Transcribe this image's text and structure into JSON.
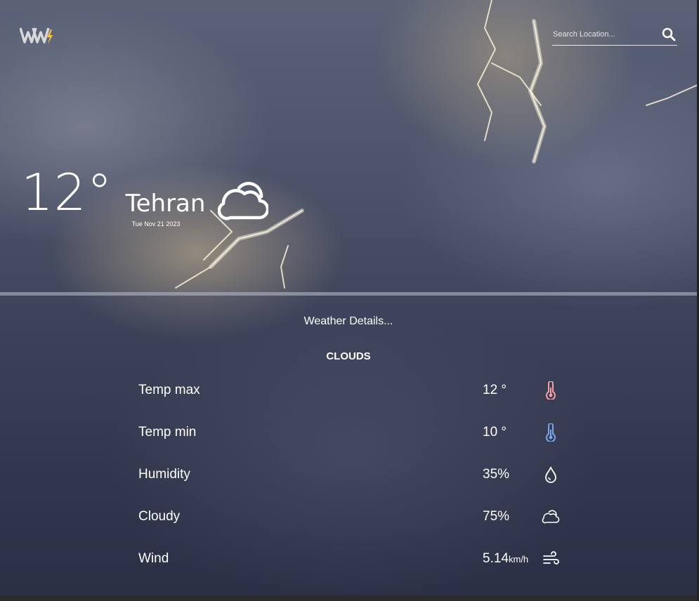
{
  "header": {
    "logo_text": "WW",
    "search": {
      "placeholder": "Search Location..."
    }
  },
  "current": {
    "temperature": "12°",
    "city": "Tehran",
    "date": "Tue Nov 21 2023",
    "condition_icon": "cloud-icon"
  },
  "details": {
    "title": "Weather Details...",
    "condition": "CLOUDS",
    "rows": [
      {
        "label": "Temp max",
        "value": "12 °",
        "unit": "",
        "icon": "thermometer-hot-icon",
        "icon_color": "#f2a0a6"
      },
      {
        "label": "Temp min",
        "value": "10 °",
        "unit": "",
        "icon": "thermometer-cold-icon",
        "icon_color": "#7aa7e8"
      },
      {
        "label": "Humidity",
        "value": "35%",
        "unit": "",
        "icon": "droplet-icon",
        "icon_color": "#ffffff"
      },
      {
        "label": "Cloudy",
        "value": "75%",
        "unit": "",
        "icon": "cloud-icon",
        "icon_color": "#ffffff"
      },
      {
        "label": "Wind",
        "value": "5.14",
        "unit": "km/h",
        "icon": "wind-icon",
        "icon_color": "#ffffff"
      }
    ]
  },
  "colors": {
    "logo_accent": "#f5c542",
    "hot": "#f2a0a6",
    "cold": "#7aa7e8"
  }
}
